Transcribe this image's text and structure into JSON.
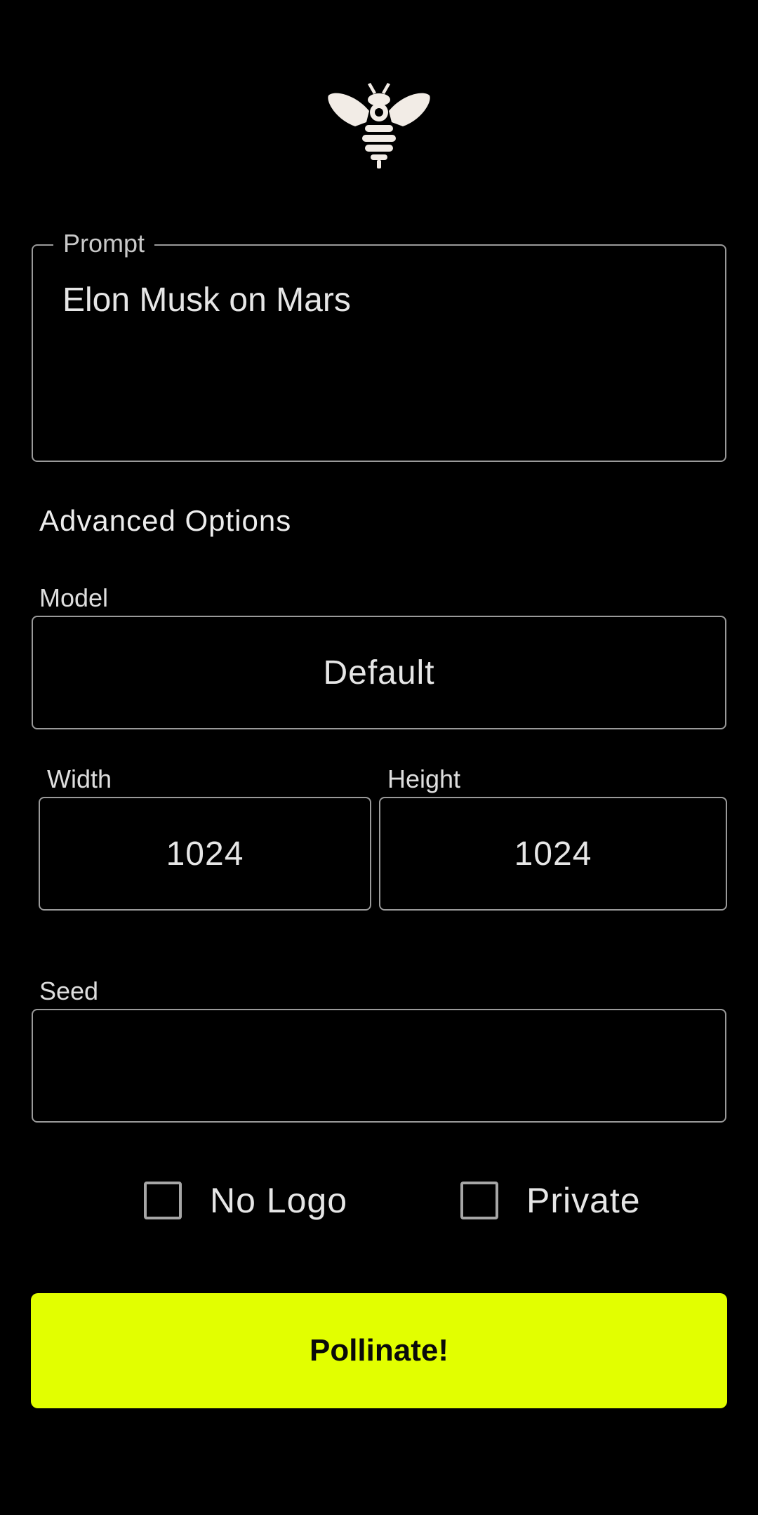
{
  "logo": {
    "icon": "bee-icon",
    "color": "#f2ece6"
  },
  "prompt": {
    "label": "Prompt",
    "value": "Elon Musk on Mars"
  },
  "advanced": {
    "title": "Advanced Options"
  },
  "model": {
    "label": "Model",
    "value": "Default"
  },
  "width": {
    "label": "Width",
    "value": "1024"
  },
  "height": {
    "label": "Height",
    "value": "1024"
  },
  "seed": {
    "label": "Seed",
    "value": ""
  },
  "options": {
    "no_logo": {
      "label": "No Logo",
      "checked": false
    },
    "private": {
      "label": "Private",
      "checked": false
    }
  },
  "submit": {
    "label": "Pollinate!",
    "color": "#e2ff00"
  }
}
